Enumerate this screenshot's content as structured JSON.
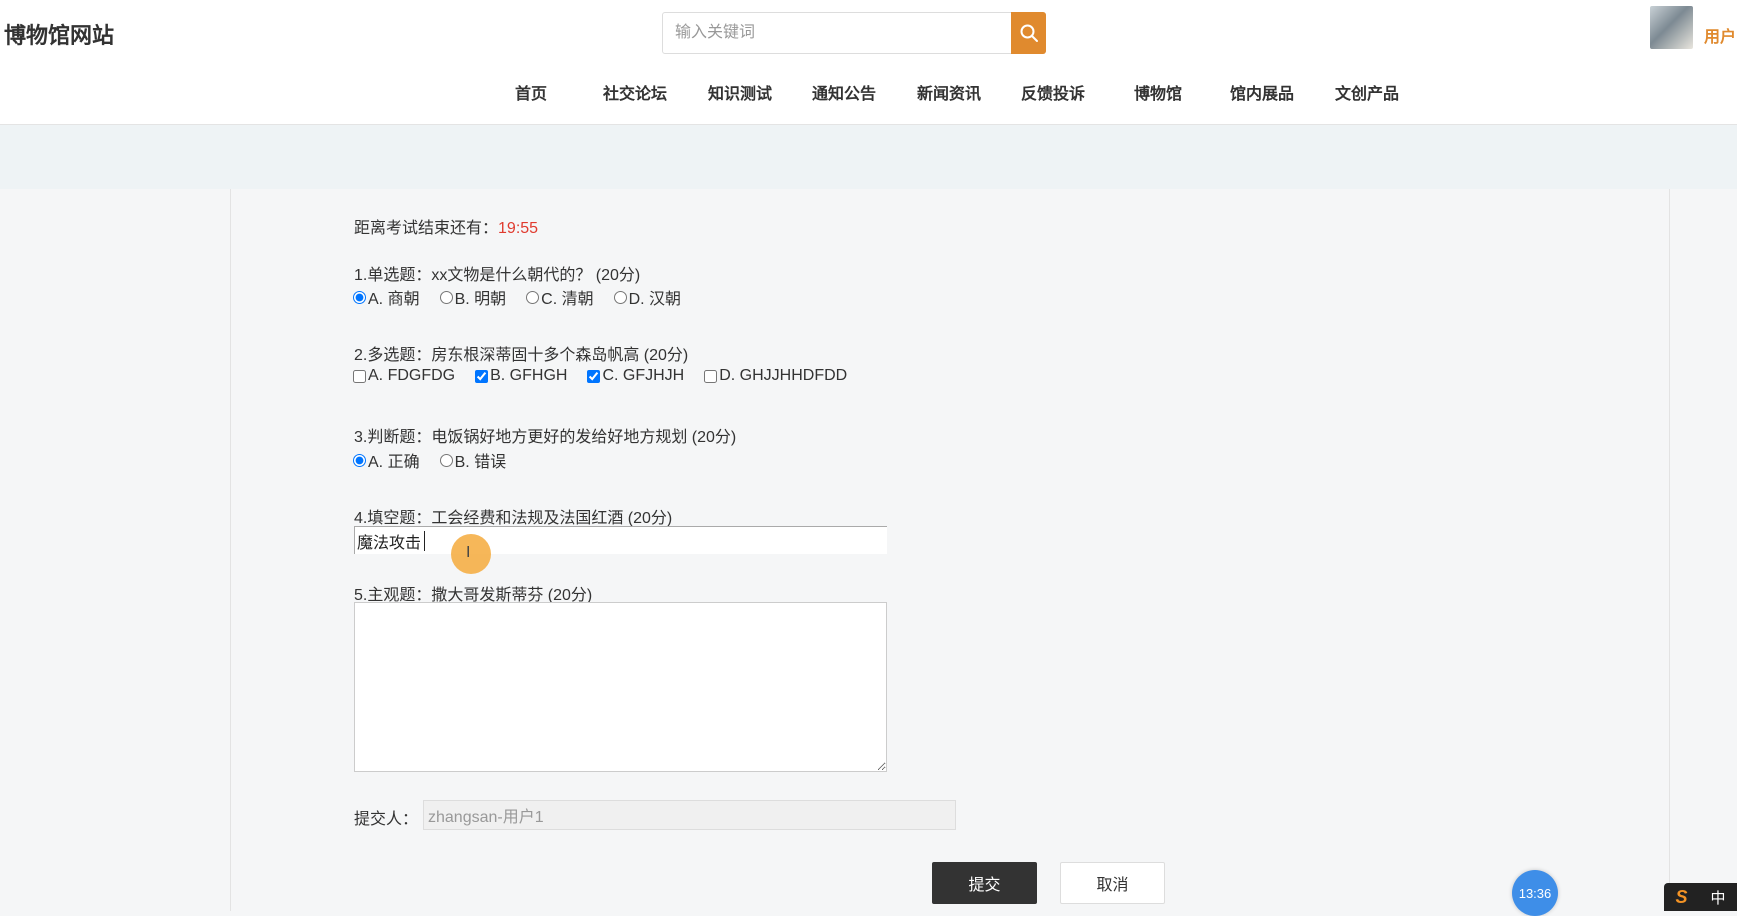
{
  "header": {
    "site_title": "博物馆网站",
    "search_placeholder": "输入关键词",
    "user_label": "用户"
  },
  "nav": [
    {
      "label": "首页"
    },
    {
      "label": "社交论坛"
    },
    {
      "label": "知识测试"
    },
    {
      "label": "通知公告"
    },
    {
      "label": "新闻资讯"
    },
    {
      "label": "反馈投诉"
    },
    {
      "label": "博物馆"
    },
    {
      "label": "馆内展品"
    },
    {
      "label": "文创产品"
    }
  ],
  "exam": {
    "timer_label": "距离考试结束还有：",
    "timer_value": "19:55",
    "q1": {
      "text": "1.单选题：xx文物是什么朝代的？ (20分)",
      "options": [
        {
          "label": "A. 商朝",
          "checked": true
        },
        {
          "label": "B. 明朝",
          "checked": false
        },
        {
          "label": "C. 清朝",
          "checked": false
        },
        {
          "label": "D. 汉朝",
          "checked": false
        }
      ]
    },
    "q2": {
      "text": "2.多选题：房东根深蒂固十多个森岛帆高 (20分)",
      "options": [
        {
          "label": "A. FDGFDG",
          "checked": false
        },
        {
          "label": "B. GFHGH",
          "checked": true
        },
        {
          "label": "C. GFJHJH",
          "checked": true
        },
        {
          "label": "D. GHJJHHDFDD",
          "checked": false
        }
      ]
    },
    "q3": {
      "text": "3.判断题：电饭锅好地方更好的发给好地方规划 (20分)",
      "options": [
        {
          "label": "A. 正确",
          "checked": true
        },
        {
          "label": "B. 错误",
          "checked": false
        }
      ]
    },
    "q4": {
      "text": "4.填空题：工会经费和法规及法国红酒 (20分)",
      "value": "魔法攻击"
    },
    "q5": {
      "text": "5.主观题：撒大哥发斯蒂芬 (20分)",
      "value": ""
    },
    "submitter_label": "提交人：",
    "submitter_value": "zhangsan-用户1",
    "submit_label": "提交",
    "cancel_label": "取消"
  },
  "overlay": {
    "clock_time": "13:36",
    "ime_logo": "S",
    "ime_mode": "中"
  },
  "colors": {
    "accent": "#e08a2e",
    "timer": "#e03b2f",
    "submit_bg": "#333333"
  }
}
